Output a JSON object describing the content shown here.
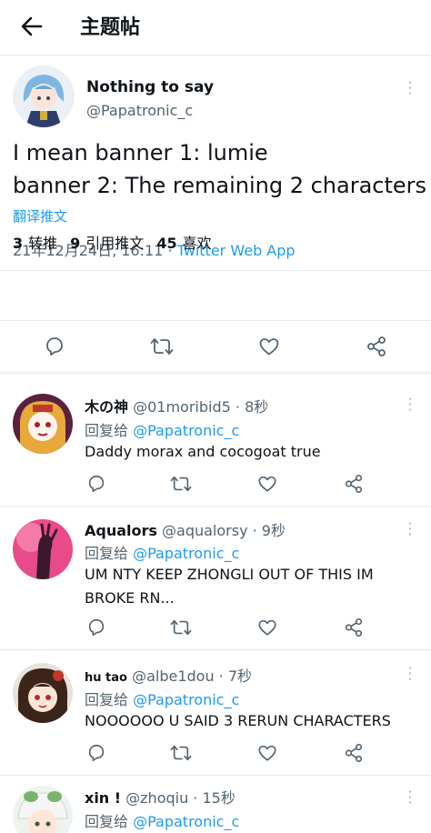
{
  "header": {
    "title": "主题帖"
  },
  "main_tweet": {
    "name": "Nothing to say",
    "handle": "@Papatronic_c",
    "text_line1": "I mean banner 1: lumie",
    "text_line2": "banner 2: The remaining 2 characters",
    "translate": "翻译推文",
    "date": "21年12月24日, 16:11 · ",
    "app": "Twitter Web App",
    "retweets": "3",
    "retweets_label": "转推",
    "quotes": "9",
    "quotes_label": "引用推文",
    "likes": "45",
    "likes_label": "喜欢"
  },
  "replies": [
    {
      "name": "木の神",
      "handle": "@01moribid5 · 8秒",
      "reply_label": "回复给 ",
      "reply_to": "@Papatronic_c",
      "text": "Daddy morax and cocogoat true"
    },
    {
      "name": "Aqualors",
      "handle": "@aqualorsy · 9秒",
      "reply_label": "回复给 ",
      "reply_to": "@Papatronic_c",
      "text_line1": "UM NTY KEEP ZHONGLI OUT OF THIS IM",
      "text_line2": "BROKE RN..."
    },
    {
      "name": "hu tao",
      "handle": "@albe1dou · 7秒",
      "reply_label": "回复给 ",
      "reply_to": "@Papatronic_c",
      "text": "NOOOOOO U SAID 3 RERUN CHARACTERS"
    },
    {
      "name": "xin !",
      "handle": "@zhoqiu · 15秒",
      "reply_label": "回复给 ",
      "reply_to": "@Papatronic_c"
    }
  ],
  "icons": [
    "back-arrow-icon",
    "more-icon",
    "reply-icon",
    "retweet-icon",
    "like-icon",
    "share-icon"
  ],
  "colors": {
    "accent": "#1d9bf0",
    "muted": "#536471",
    "text": "#0f1419"
  }
}
